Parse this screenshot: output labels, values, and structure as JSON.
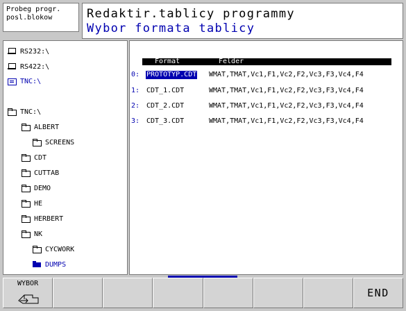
{
  "header": {
    "mode_line1": "Probeg progr.",
    "mode_line2": "posl.blokow",
    "title_line1": "Redaktir.tablicy programmy",
    "title_line2": "Wybor formata tablicy"
  },
  "tree": {
    "items": [
      {
        "label": "RS232:\\",
        "icon": "drive-icon"
      },
      {
        "label": "RS422:\\",
        "icon": "drive-icon"
      },
      {
        "label": "TNC:\\",
        "icon": "tnc-drive-icon",
        "active": true
      },
      {
        "label": "TNC:\\",
        "icon": "folder-icon"
      },
      {
        "label": "ALBERT",
        "icon": "folder-icon"
      },
      {
        "label": "SCREENS",
        "icon": "folder-icon"
      },
      {
        "label": "CDT",
        "icon": "folder-icon"
      },
      {
        "label": "CUTTAB",
        "icon": "folder-icon"
      },
      {
        "label": "DEMO",
        "icon": "folder-icon"
      },
      {
        "label": "HE",
        "icon": "folder-icon"
      },
      {
        "label": "HERBERT",
        "icon": "folder-icon"
      },
      {
        "label": "NK",
        "icon": "folder-icon"
      },
      {
        "label": "CYCWORK",
        "icon": "folder-icon"
      },
      {
        "label": "DUMPS",
        "icon": "folder-open-icon",
        "active": true
      }
    ]
  },
  "table": {
    "col_format": "Format",
    "col_felder": "Felder",
    "rows": [
      {
        "idx": "0:",
        "format": "PROTOTYP.CDT",
        "felder": "WMAT,TMAT,Vc1,F1,Vc2,F2,Vc3,F3,Vc4,F4",
        "selected": true
      },
      {
        "idx": "1:",
        "format": "CDT_1.CDT",
        "felder": "WMAT,TMAT,Vc1,F1,Vc2,F2,Vc3,F3,Vc4,F4"
      },
      {
        "idx": "2:",
        "format": "CDT_2.CDT",
        "felder": "WMAT,TMAT,Vc1,F1,Vc2,F2,Vc3,F3,Vc4,F4"
      },
      {
        "idx": "3:",
        "format": "CDT_3.CDT",
        "felder": "WMAT,TMAT,Vc1,F1,Vc2,F2,Vc3,F3,Vc4,F4"
      }
    ]
  },
  "softkeys": {
    "wybor": "WYBOR",
    "end": "END"
  },
  "colors": {
    "accent": "#0000b0",
    "background": "#c8c8c8"
  }
}
